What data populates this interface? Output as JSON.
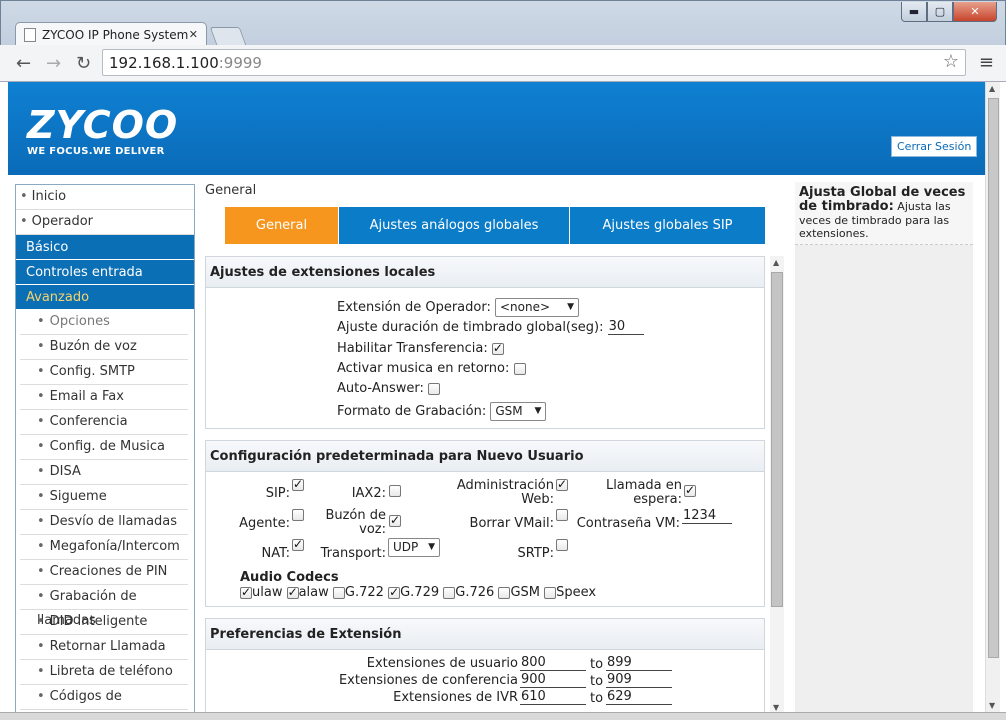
{
  "browser": {
    "tab_title": "ZYCOO IP Phone System (",
    "tab_close": "✕",
    "url_host": "192.168.1.100",
    "url_port": ":9999",
    "window_controls": {
      "minimize": "▬",
      "maximize": "▢",
      "close": "✕"
    },
    "nav_icons": {
      "back": "←",
      "forward": "→",
      "reload": "↻",
      "star": "☆",
      "menu": "≡"
    }
  },
  "header": {
    "brand": "ZYCOO",
    "slogan": "WE FOCUS.WE DELIVER",
    "logout": "Cerrar Sesión",
    "brand_color": "#0b6fb5"
  },
  "sidebar": {
    "top_items": [
      "Inicio",
      "Operador"
    ],
    "sections": [
      "Básico",
      "Controles entrada",
      "Avanzado"
    ],
    "sub_items": [
      "Opciones",
      "Buzón de voz",
      "Config. SMTP",
      "Email a Fax",
      "Conferencia",
      "Config. de Musica",
      "DISA",
      "Sigueme",
      "Desvío de llamadas",
      "Megafonía/Intercom",
      "Creaciones de PIN",
      "Grabación de llamadas",
      "DID inteligente",
      "Retornar Llamada",
      "Libreta de teléfono",
      "Códigos de funciones"
    ]
  },
  "main": {
    "breadcrumb": "General",
    "tabs": [
      "General",
      "Ajustes análogos globales",
      "Ajustes globales SIP"
    ],
    "sec1": {
      "title": "Ajustes de extensiones locales",
      "operator_label": "Extensión de Operador:",
      "operator_value": "<none>",
      "ring_label": "Ajuste duración de timbrado global(seg):",
      "ring_value": "30",
      "transfer_label": "Habilitar Transferencia:",
      "music_label": "Activar musica en retorno:",
      "autoanswer_label": "Auto-Answer:",
      "format_label": "Formato de Grabación:",
      "format_value": "GSM"
    },
    "sec2": {
      "title": "Configuración predeterminada para Nuevo Usuario",
      "sip": "SIP:",
      "iax2": "IAX2:",
      "admin_web_1": "Administración",
      "admin_web_2": "Web:",
      "callwait_1": "Llamada en",
      "callwait_2": "espera:",
      "agent": "Agente:",
      "vm_1": "Buzón de",
      "vm_2": "voz:",
      "delete_vm": "Borrar VMail:",
      "vm_pass": "Contraseña VM:",
      "vm_pass_value": "1234",
      "nat": "NAT:",
      "transport": "Transport:",
      "transport_value": "UDP",
      "srtp": "SRTP:",
      "codecs_title": "Audio Codecs",
      "codecs": [
        "ulaw",
        "alaw",
        "G.722",
        "G.729",
        "G.726",
        "GSM",
        "Speex"
      ]
    },
    "sec3": {
      "title": "Preferencias de Extensión",
      "user_label": "Extensiones de usuario",
      "user_from": "800",
      "user_to": "899",
      "conf_label": "Extensiones de conferencia",
      "conf_from": "900",
      "conf_to": "909",
      "ivr_label": "Extensiones de IVR",
      "ivr_from": "610",
      "ivr_to": "629",
      "to_word": "to"
    }
  },
  "help": {
    "title": "Ajusta Global de veces de timbrado:",
    "text": " Ajusta las veces de timbrado para las extensiones."
  }
}
